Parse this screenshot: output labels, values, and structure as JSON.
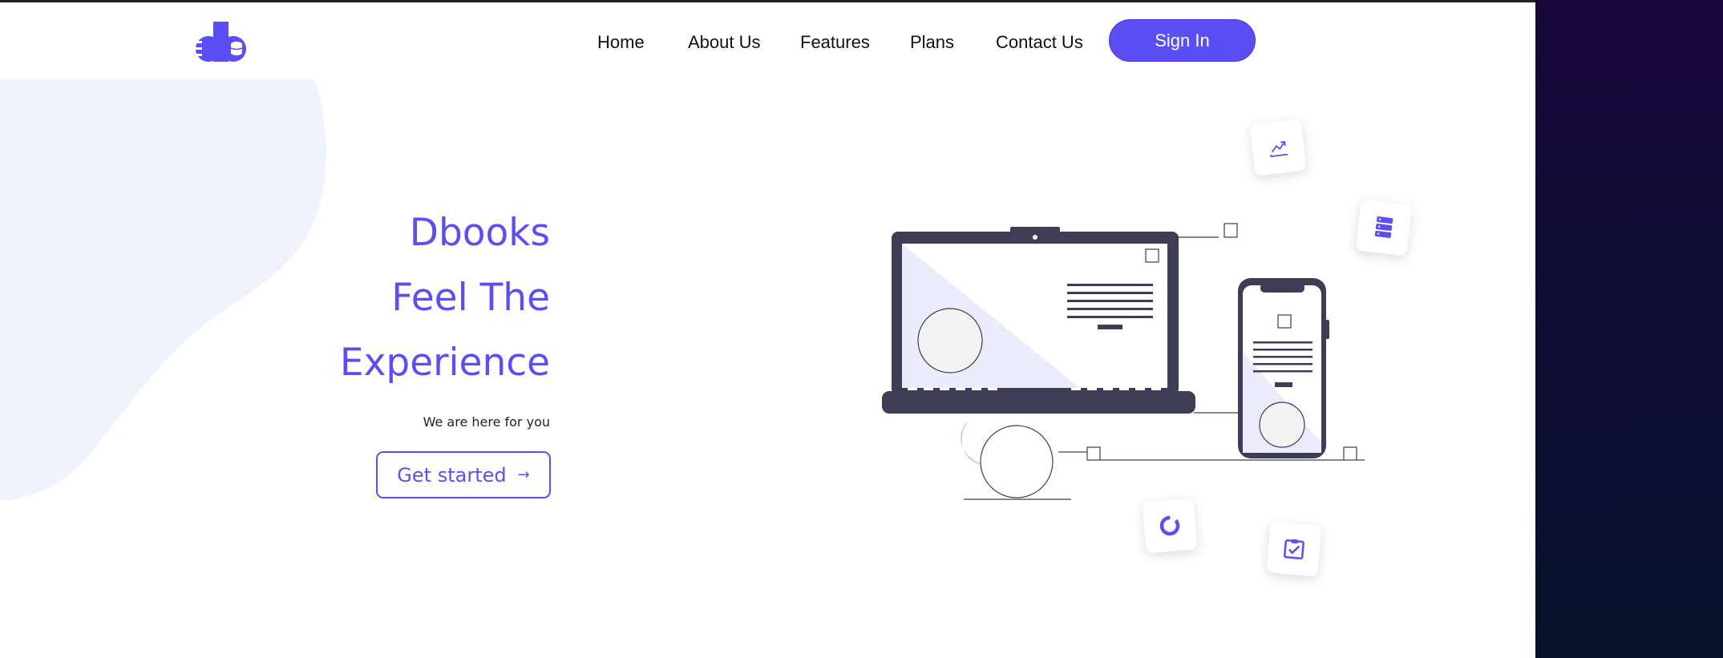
{
  "brand": {
    "accent": "#5b4ef4",
    "dark": "#3f3d56",
    "logo_icon": "db-logo-icon"
  },
  "nav": {
    "items": [
      {
        "label": "Home"
      },
      {
        "label": "About Us"
      },
      {
        "label": "Features"
      },
      {
        "label": "Plans"
      },
      {
        "label": "Contact Us"
      }
    ],
    "signin_label": "Sign In"
  },
  "hero": {
    "lines": [
      "Dbooks",
      "Feel The",
      "Experience"
    ],
    "subtitle": "We are here for you",
    "cta_label": "Get started",
    "cta_icon": "arrow-right-icon"
  },
  "floating_cards": [
    {
      "icon": "trending-up-icon"
    },
    {
      "icon": "server-stack-icon"
    },
    {
      "icon": "donut-chart-icon"
    },
    {
      "icon": "checklist-icon"
    }
  ]
}
